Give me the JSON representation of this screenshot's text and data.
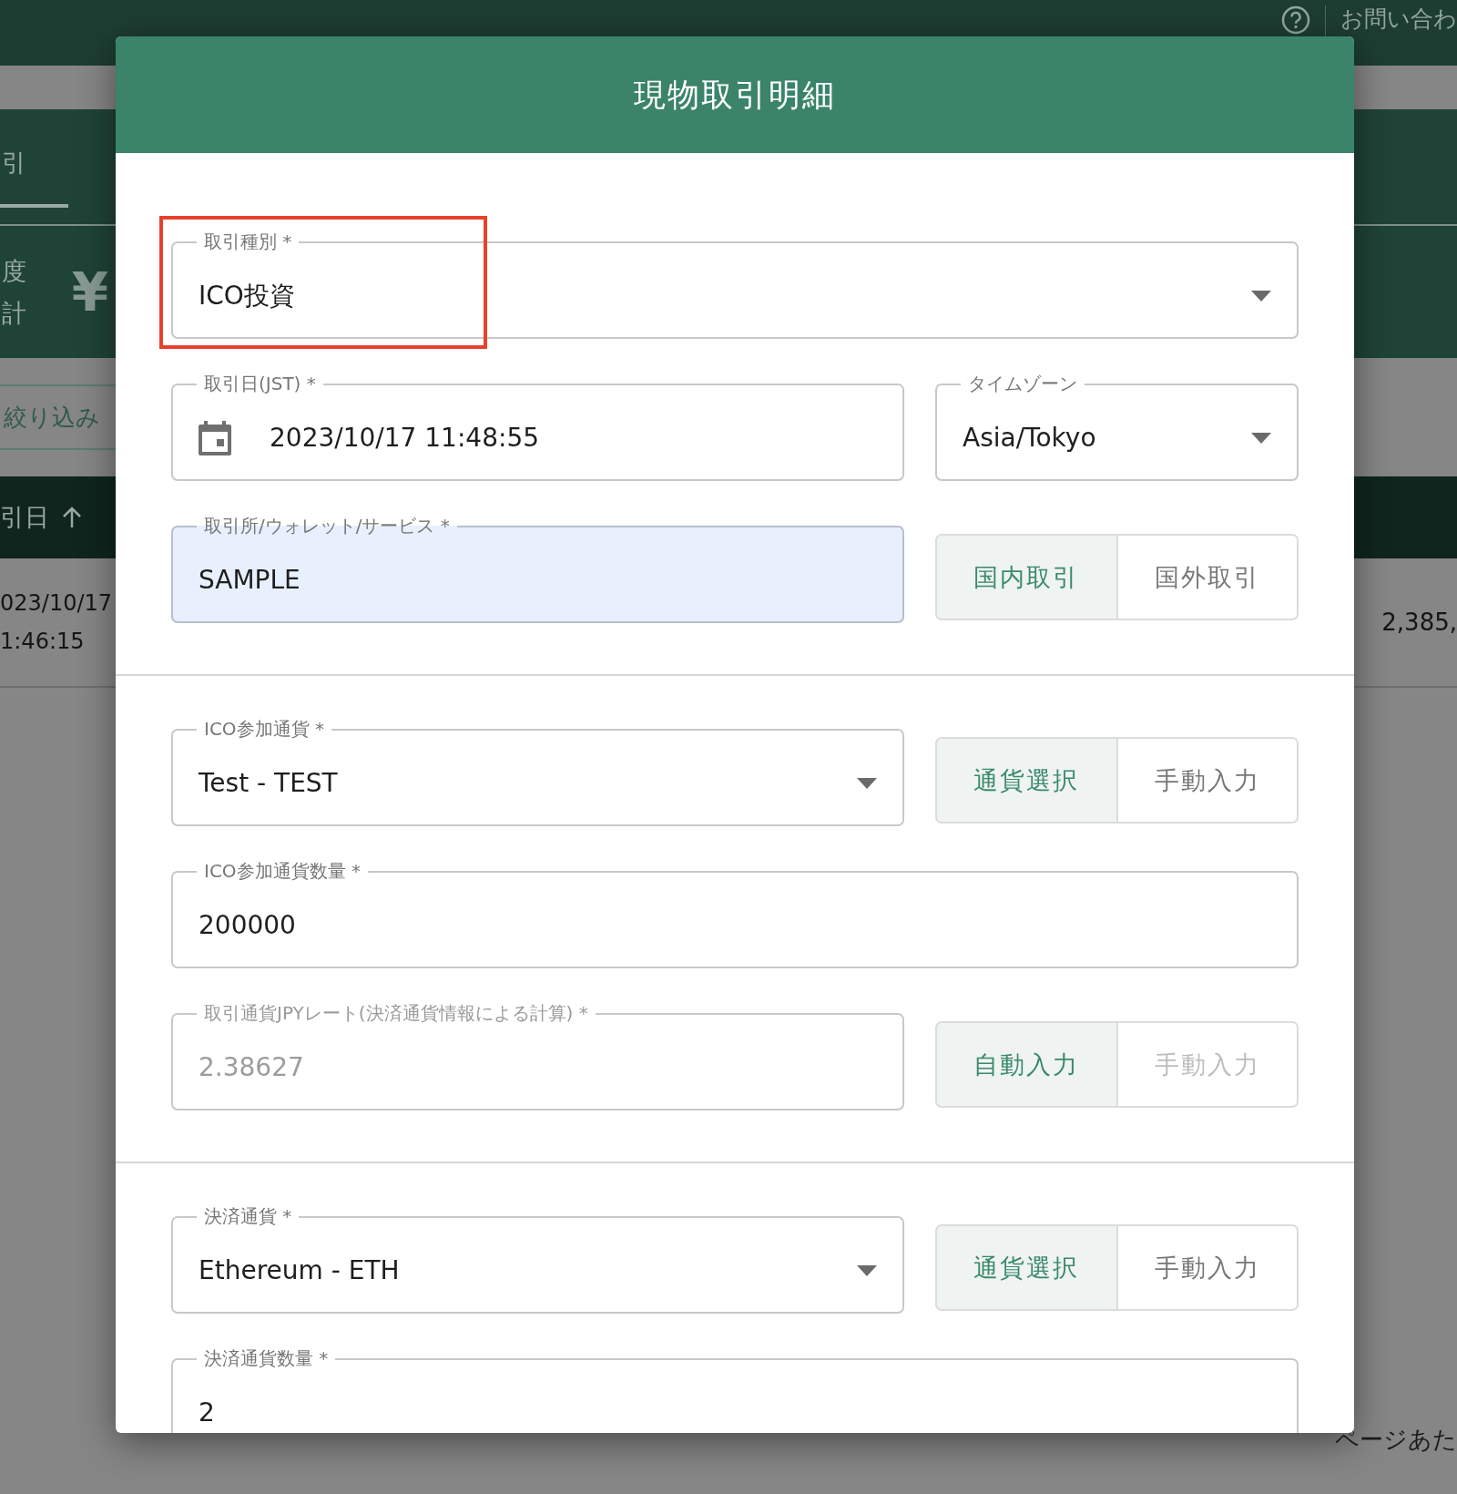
{
  "app_bar": {
    "contact_link": "お問い合わ"
  },
  "background": {
    "tabs": [
      {
        "label": "引",
        "selected": true
      }
    ],
    "summary_labels": [
      "度",
      "計"
    ],
    "currency_symbol": "¥",
    "filter_button": "絞り込み",
    "table_header": "引日",
    "row": {
      "date": "023/10/17",
      "time": "1:46:15",
      "amount": "2,385,"
    },
    "pagination": "ページあた"
  },
  "dialog": {
    "title": "現物取引明細",
    "sections": [
      {
        "rows": [
          {
            "items": [
              {
                "kind": "select",
                "label": "取引種別 *",
                "value": "ICO投資",
                "disabled": false,
                "autofilled": false,
                "highlighted": true
              }
            ]
          },
          {
            "items": [
              {
                "kind": "date",
                "label": "取引日(JST) *",
                "value": "2023/10/17 11:48:55",
                "disabled": false,
                "autofilled": false,
                "highlighted": false
              },
              {
                "kind": "select",
                "label": "タイムゾーン",
                "value": "Asia/Tokyo",
                "disabled": false,
                "autofilled": false,
                "highlighted": false
              }
            ]
          },
          {
            "items": [
              {
                "kind": "text",
                "label": "取引所/ウォレット/サービス *",
                "value": "SAMPLE",
                "disabled": false,
                "autofilled": true,
                "highlighted": false
              },
              {
                "kind": "toggle",
                "options": [
                  {
                    "label": "国内取引",
                    "selected": true,
                    "disabled": false
                  },
                  {
                    "label": "国外取引",
                    "selected": false,
                    "disabled": false
                  }
                ]
              }
            ]
          }
        ]
      },
      {
        "rows": [
          {
            "items": [
              {
                "kind": "select",
                "label": "ICO参加通貨 *",
                "value": "Test - TEST",
                "disabled": false,
                "autofilled": false,
                "highlighted": false
              },
              {
                "kind": "toggle",
                "options": [
                  {
                    "label": "通貨選択",
                    "selected": true,
                    "disabled": false
                  },
                  {
                    "label": "手動入力",
                    "selected": false,
                    "disabled": false
                  }
                ]
              }
            ]
          },
          {
            "items": [
              {
                "kind": "text",
                "label": "ICO参加通貨数量 *",
                "value": "200000",
                "disabled": false,
                "autofilled": false,
                "highlighted": false
              }
            ]
          },
          {
            "items": [
              {
                "kind": "text",
                "label": "取引通貨JPYレート(決済通貨情報による計算) *",
                "value": "2.38627",
                "disabled": true,
                "autofilled": false,
                "highlighted": false
              },
              {
                "kind": "toggle",
                "options": [
                  {
                    "label": "自動入力",
                    "selected": true,
                    "disabled": false
                  },
                  {
                    "label": "手動入力",
                    "selected": false,
                    "disabled": true
                  }
                ]
              }
            ]
          }
        ]
      },
      {
        "rows": [
          {
            "items": [
              {
                "kind": "select",
                "label": "決済通貨 *",
                "value": "Ethereum - ETH",
                "disabled": false,
                "autofilled": false,
                "highlighted": false
              },
              {
                "kind": "toggle",
                "options": [
                  {
                    "label": "通貨選択",
                    "selected": true,
                    "disabled": false
                  },
                  {
                    "label": "手動入力",
                    "selected": false,
                    "disabled": false
                  }
                ]
              }
            ]
          },
          {
            "items": [
              {
                "kind": "text",
                "label": "決済通貨数量 *",
                "value": "2",
                "disabled": false,
                "autofilled": false,
                "highlighted": false
              }
            ]
          }
        ]
      }
    ]
  }
}
